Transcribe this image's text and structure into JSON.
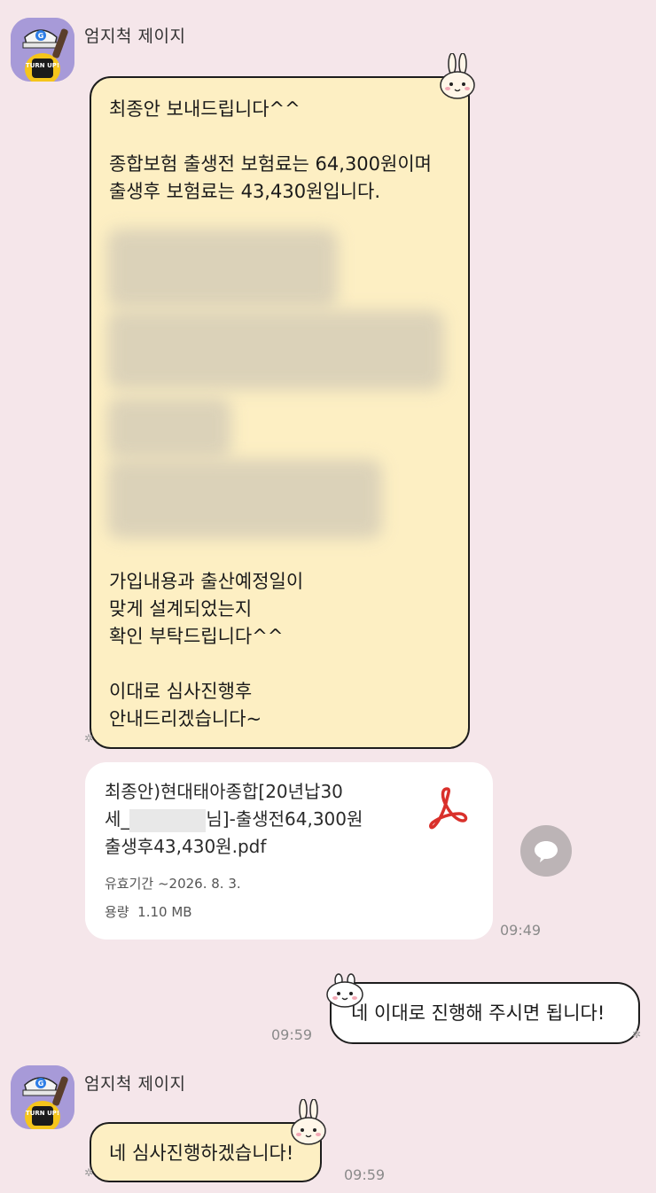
{
  "colors": {
    "background": "#f5e6ea",
    "bubble_yellow": "#fdefc3",
    "bubble_border": "#1d1d1d",
    "pdf_red": "#d9302b"
  },
  "messages": [
    {
      "sender": "엄지척 제이지",
      "lines_top": "최종안 보내드립니다^^\n\n종합보험 출생전 보험료는 64,300원이며\n출생후 보험료는 43,430원입니다.",
      "lines_bottom": "가입내용과 출산예정일이\n맞게 설계되었는지\n확인 부탁드립니다^^\n\n이대로 심사진행후\n안내드리겠습니다~"
    }
  ],
  "file": {
    "name_line1": "최종안)현대태아종합[20년납30",
    "name_line2_prefix": "세_",
    "name_line2_suffix": "님]-출생전64,300원",
    "name_line3": "출생후43,430원.pdf",
    "expiry_label": "유효기간",
    "expiry_value": "~2026. 8. 3.",
    "size_label": "용량",
    "size_value": "1.10 MB",
    "icon": "pdf-icon",
    "time": "09:49"
  },
  "reply": {
    "text": "네 이대로 진행해 주시면 됩니다!",
    "time": "09:59"
  },
  "message2": {
    "sender": "엄지척 제이지",
    "text": "네 심사진행하겠습니다!",
    "time": "09:59"
  },
  "avatar_badge": "G",
  "avatar_shirt": "TURN UP!"
}
